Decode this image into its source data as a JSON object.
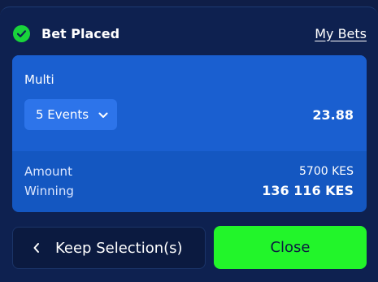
{
  "header": {
    "title": "Bet Placed",
    "link_label": "My Bets"
  },
  "bet": {
    "type": "Multi",
    "events_label": "5 Events",
    "odds": "23.88",
    "amount_label": "Amount",
    "amount_value": "5700 KES",
    "winning_label": "Winning",
    "winning_value": "136 116 KES"
  },
  "actions": {
    "keep_label": "Keep Selection(s)",
    "close_label": "Close"
  },
  "colors": {
    "success": "#19d43b",
    "close_button": "#22f52a",
    "card": "#1a5fd0",
    "background": "#0e2150"
  },
  "icons": {
    "status": "check-circle-icon",
    "dropdown": "chevron-down-icon",
    "back": "chevron-left-icon"
  }
}
